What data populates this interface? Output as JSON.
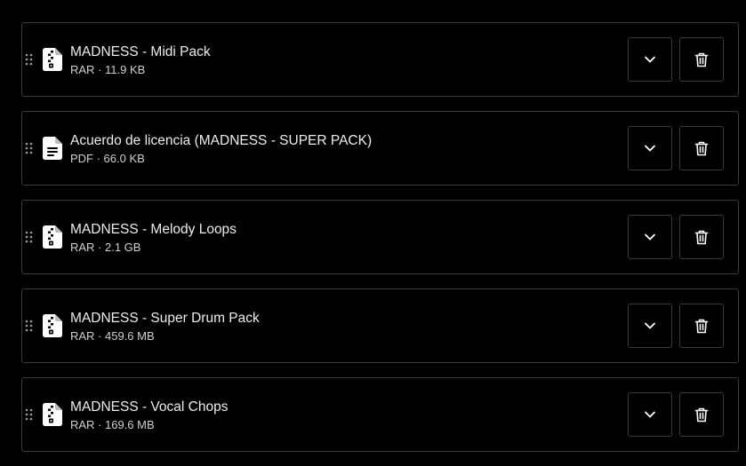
{
  "files": [
    {
      "name": "MADNESS - Midi Pack",
      "meta": "RAR · 11.9 KB",
      "icon": "archive-file-icon"
    },
    {
      "name": "Acuerdo de licencia (MADNESS - SUPER PACK)",
      "meta": "PDF · 66.0 KB",
      "icon": "document-file-icon"
    },
    {
      "name": "MADNESS - Melody Loops",
      "meta": "RAR · 2.1 GB",
      "icon": "archive-file-icon"
    },
    {
      "name": "MADNESS - Super Drum Pack",
      "meta": "RAR · 459.6 MB",
      "icon": "archive-file-icon"
    },
    {
      "name": "MADNESS - Vocal Chops",
      "meta": "RAR · 169.6 MB",
      "icon": "archive-file-icon"
    }
  ],
  "icons": {
    "drag": "drag-handle-icon",
    "expand": "chevron-down-icon",
    "delete": "trash-icon"
  },
  "colors": {
    "background": "#000000",
    "border": "#3a3a3a",
    "text": "#ededed",
    "icon": "#ffffff"
  }
}
